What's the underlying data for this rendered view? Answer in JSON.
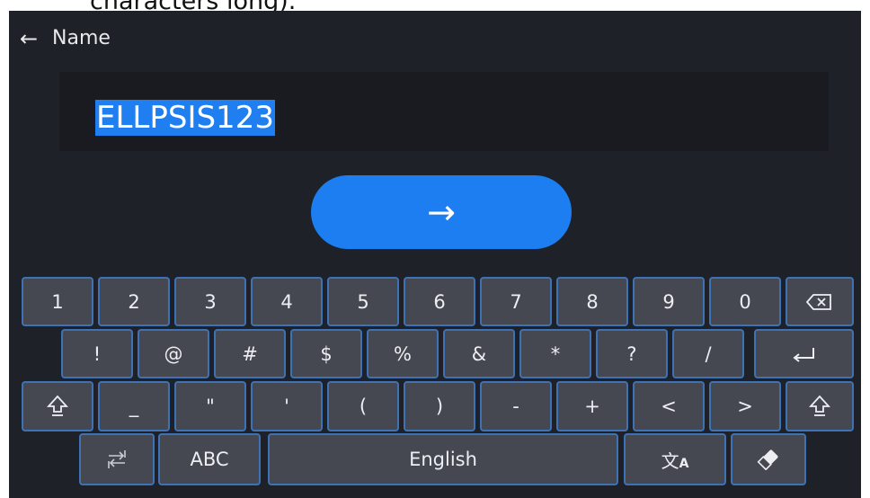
{
  "caption_fragment": "characters long).",
  "header": {
    "back_icon": "back-arrow-icon",
    "title": "Name"
  },
  "input": {
    "value": "ELLPSIS123",
    "selection_color": "#1f7ff0"
  },
  "confirm_button": {
    "label": "→",
    "color": "#1d7ef1"
  },
  "keyboard": {
    "row1": [
      "1",
      "2",
      "3",
      "4",
      "5",
      "6",
      "7",
      "8",
      "9",
      "0"
    ],
    "row1_end_icon": "backspace-icon",
    "row2": [
      "!",
      "@",
      "#",
      "$",
      "%",
      "&",
      "*",
      "?",
      "/"
    ],
    "row2_end_icon": "enter-icon",
    "row3_start_icon": "shift-icon",
    "row3": [
      "_",
      "\"",
      "'",
      "(",
      ")",
      "-",
      "+",
      "<",
      ">"
    ],
    "row3_end_icon": "shift-icon",
    "row4_switch_icon": "switch-layout-icon",
    "row4_abc": "ABC",
    "row4_space": "English",
    "row4_translate_icon": "translate-icon",
    "row4_clear_icon": "eraser-icon",
    "key_border_color": "#3f72b5"
  }
}
